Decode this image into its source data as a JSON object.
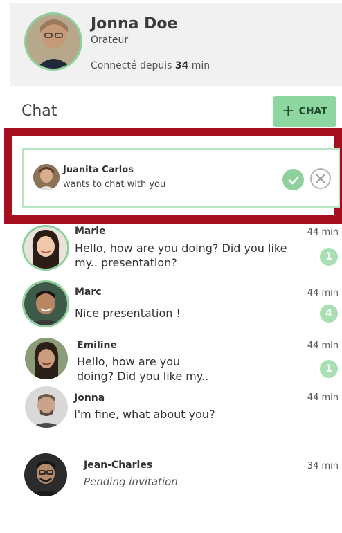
{
  "profile": {
    "name": "Jonna Doe",
    "role": "Orateur",
    "status_prefix": "Connecté depuis ",
    "status_value": "34",
    "status_suffix": " min"
  },
  "chat": {
    "title": "Chat",
    "add_button_icon": "+",
    "add_button_label": "CHAT"
  },
  "invitation": {
    "name": "Juanita Carlos",
    "text": "wants to chat with you"
  },
  "conversations": [
    {
      "name": "Marie",
      "message": "Hello, how are you doing? Did you like my.. presentation?",
      "time": "44 min",
      "unread": "1"
    },
    {
      "name": "Marc",
      "message": "Nice presentation !",
      "time": "44 min",
      "unread": "4"
    },
    {
      "name": "Emiline",
      "message": "Hello, how are you doing? Did you like my..",
      "time": "44 min",
      "unread": "1"
    },
    {
      "name": "Jonna",
      "message": "I'm fine, what about you?",
      "time": "44 min"
    },
    {
      "name": "Jean-Charles",
      "message": "Pending invitation",
      "time": "34 min"
    }
  ],
  "colors": {
    "accent_green": "#8ed19c",
    "highlight_red": "#a50f1f",
    "badge_green": "#a8dfb3"
  }
}
